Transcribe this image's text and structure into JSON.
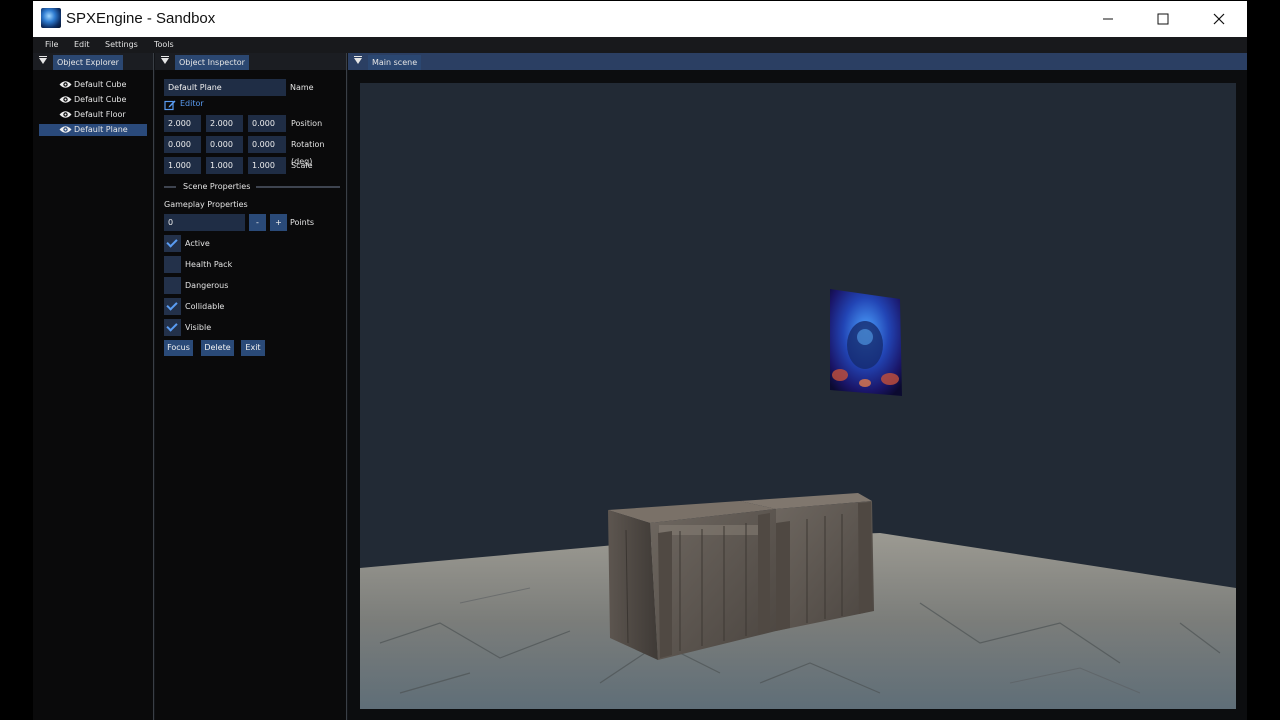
{
  "window": {
    "title": "SPXEngine - Sandbox"
  },
  "menu": {
    "items": [
      "File",
      "Edit",
      "Settings",
      "Tools"
    ]
  },
  "explorer": {
    "tab": "Object Explorer",
    "items": [
      {
        "label": "Default Cube"
      },
      {
        "label": "Default Cube"
      },
      {
        "label": "Default Floor"
      },
      {
        "label": "Default Plane"
      }
    ]
  },
  "inspector": {
    "tab": "Object Inspector",
    "name_value": "Default Plane",
    "name_label": "Name",
    "editor_label": "Editor",
    "position": {
      "x": "2.000",
      "y": "2.000",
      "z": "0.000",
      "label": "Position"
    },
    "rotation": {
      "x": "0.000",
      "y": "0.000",
      "z": "0.000",
      "label": "Rotation (deg)"
    },
    "scale": {
      "x": "1.000",
      "y": "1.000",
      "z": "1.000",
      "label": "Scale"
    },
    "scene_properties": "Scene Properties",
    "gameplay_properties": "Gameplay Properties",
    "points": {
      "value": "0",
      "minus": "-",
      "plus": "+",
      "label": "Points"
    },
    "checkboxes": [
      {
        "label": "Active",
        "checked": true
      },
      {
        "label": "Health Pack",
        "checked": false
      },
      {
        "label": "Dangerous",
        "checked": false
      },
      {
        "label": "Collidable",
        "checked": true
      },
      {
        "label": "Visible",
        "checked": true
      }
    ],
    "buttons": {
      "focus": "Focus",
      "delete": "Delete",
      "exit": "Exit"
    }
  },
  "scene": {
    "tab": "Main scene"
  },
  "colors": {
    "accent": "#2a4a78",
    "tab_active": "#2b4771",
    "viewport_bg": "#222a35",
    "checkmark": "#5a9cf2"
  }
}
